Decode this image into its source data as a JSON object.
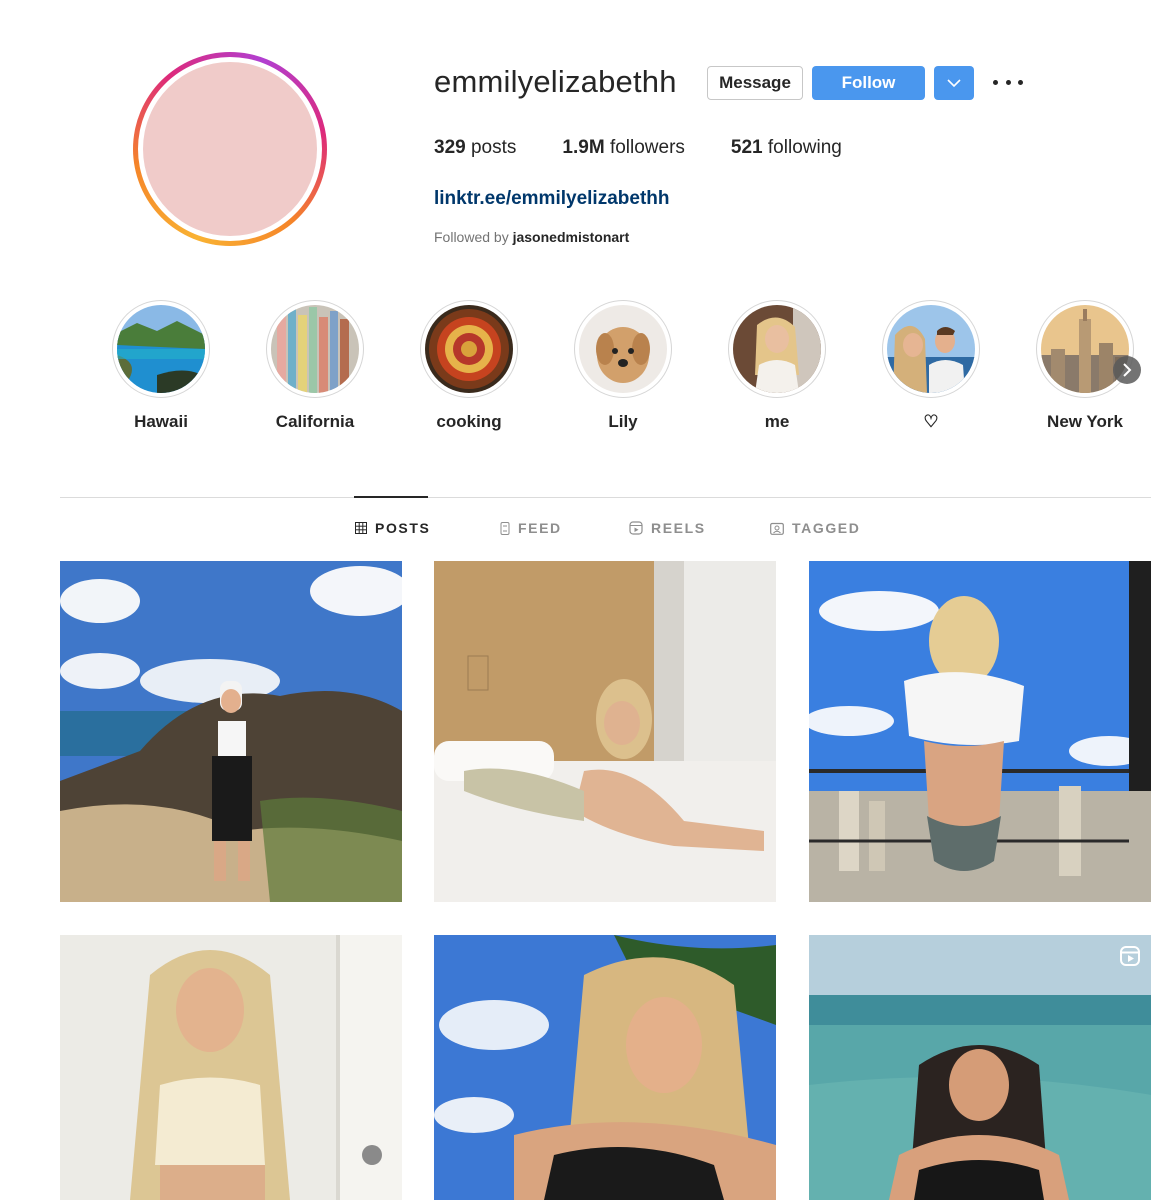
{
  "profile": {
    "username": "emmilyelizabethh",
    "message_label": "Message",
    "follow_label": "Follow",
    "posts_count": "329",
    "posts_word": "posts",
    "followers_count": "1.9M",
    "followers_word": "followers",
    "following_count": "521",
    "following_word": "following",
    "link": "linktr.ee/emmilyelizabethh",
    "followed_by_prefix": "Followed by",
    "followed_by_user": "jasonedmistonart"
  },
  "highlights": [
    {
      "label": "Hawaii"
    },
    {
      "label": "California"
    },
    {
      "label": "cooking"
    },
    {
      "label": "Lily"
    },
    {
      "label": "me"
    },
    {
      "label": "♡"
    },
    {
      "label": "New York"
    }
  ],
  "tabs": [
    {
      "label": "POSTS",
      "active": true
    },
    {
      "label": "FEED",
      "active": false
    },
    {
      "label": "REELS",
      "active": false
    },
    {
      "label": "TAGGED",
      "active": false
    }
  ],
  "icons": {
    "more": "more-options-icon",
    "chevron": "chevron-down-icon",
    "next": "chevron-right-icon",
    "posts": "grid-icon",
    "feed": "feed-icon",
    "reels": "reels-icon",
    "tagged": "tagged-icon",
    "reel_badge": "reel-badge-icon"
  },
  "colors": {
    "primary_button": "#4a97ee",
    "link": "#00376b",
    "text": "#262626",
    "muted": "#737373"
  }
}
